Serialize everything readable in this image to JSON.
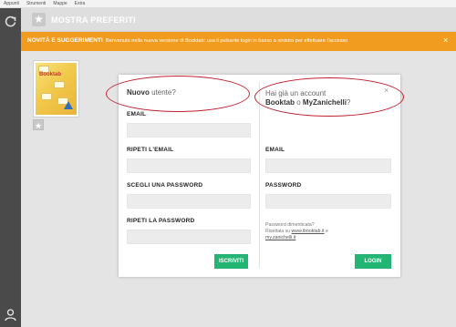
{
  "menubar": {
    "items": [
      "Appunti",
      "Strumenti",
      "Mappe",
      "Extra"
    ]
  },
  "topbar": {
    "favorites_label": "MOSTRA PREFERITI"
  },
  "newsbar": {
    "title": "NOVITÀ E SUGGERIMENTI",
    "text": "Benvenuto nella nuova versione di Booktab: usa il pulsante login in basso a sinistra per effettuare l'accesso"
  },
  "book": {
    "cover_title": "Booktab"
  },
  "dialog": {
    "left": {
      "heading_bold": "Nuovo",
      "heading_rest": " utente?",
      "email_label": "EMAIL",
      "repeat_email_label": "RIPETI L'EMAIL",
      "password_label": "SCEGLI UNA PASSWORD",
      "repeat_password_label": "RIPETI LA PASSWORD",
      "email_value": "",
      "repeat_email_value": "",
      "password_value": "",
      "repeat_password_value": "",
      "submit_label": "ISCRIVITI"
    },
    "right": {
      "heading_line1": "Hai già un account",
      "heading_booktab": "Booktab",
      "heading_o": " o ",
      "heading_myz": "MyZanichelli",
      "heading_q": "?",
      "email_label": "EMAIL",
      "password_label": "PASSWORD",
      "email_value": "",
      "password_value": "",
      "forgot_line1": "Password dimenticata?",
      "forgot_line2_prefix": "Risettala su ",
      "forgot_link1": "www.ibooktab.it",
      "forgot_line2_suffix": " e",
      "forgot_link2": "my.zanichelli.it",
      "submit_label": "LOGIN"
    },
    "close_glyph": "×"
  },
  "colors": {
    "accent_orange": "#f29c1f",
    "button_green": "#22b573",
    "annotation_red": "#c0212e",
    "sidebar": "#4a4a4a"
  },
  "icons": [
    "refresh-icon",
    "star-icon",
    "user-icon",
    "close-icon"
  ]
}
